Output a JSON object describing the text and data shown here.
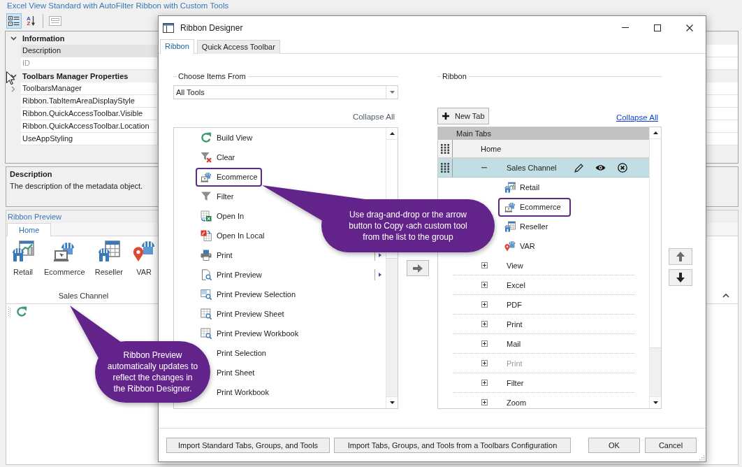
{
  "app": {
    "title": "Excel View Standard with AutoFilter Ribbon with Custom Tools",
    "toolbar": [
      {
        "kind": "categorized",
        "selected": true,
        "disabled": false
      },
      {
        "kind": "alphabetical",
        "selected": false,
        "disabled": false,
        "letters": [
          "A",
          "Z"
        ]
      },
      {
        "kind": "property-pages",
        "selected": false,
        "disabled": true
      }
    ],
    "property_grid": {
      "categories": [
        {
          "name": "Information",
          "expanded": true,
          "properties": [
            {
              "name": "Description",
              "selected": true,
              "readonly": false,
              "expandable": false
            },
            {
              "name": "ID",
              "selected": false,
              "readonly": true,
              "expandable": false
            }
          ]
        },
        {
          "name": "Toolbars Manager Properties",
          "expanded": true,
          "properties": [
            {
              "name": "ToolbarsManager",
              "selected": false,
              "readonly": false,
              "expandable": true
            },
            {
              "name": "Ribbon.TabItemAreaDisplayStyle",
              "selected": false,
              "readonly": false,
              "expandable": false
            },
            {
              "name": "Ribbon.QuickAccessToolbar.Visible",
              "selected": false,
              "readonly": false,
              "expandable": false
            },
            {
              "name": "Ribbon.QuickAccessToolbar.Location",
              "selected": false,
              "readonly": false,
              "expandable": false
            },
            {
              "name": "UseAppStyling",
              "selected": false,
              "readonly": false,
              "expandable": false
            }
          ]
        }
      ]
    },
    "description_panel": {
      "title": "Description",
      "text": "The description of the metadata object."
    },
    "ribbon_preview": {
      "title": "Ribbon Preview",
      "tabs": [
        {
          "label": "Home",
          "selected": true
        }
      ],
      "groups": [
        {
          "label": "Sales Channel",
          "tools": [
            {
              "label": "Retail"
            },
            {
              "label": "Ecommerce"
            },
            {
              "label": "Reseller"
            },
            {
              "label": "VAR"
            }
          ]
        }
      ]
    }
  },
  "dialog": {
    "title": "Ribbon Designer",
    "tabs": [
      {
        "label": "Ribbon",
        "selected": true
      },
      {
        "label": "Quick Access Toolbar",
        "selected": false
      }
    ],
    "source": {
      "heading": "Choose Items From",
      "dropdown": {
        "value": "All Tools"
      },
      "collapse_all": "Collapse All",
      "items": [
        {
          "label": "Build View",
          "selected": false,
          "highlighted": false,
          "submenu": false
        },
        {
          "label": "Clear",
          "selected": false,
          "highlighted": false,
          "submenu": false
        },
        {
          "label": "Ecommerce",
          "selected": false,
          "highlighted": true,
          "submenu": false
        },
        {
          "label": "Filter",
          "selected": false,
          "highlighted": false,
          "submenu": false
        },
        {
          "label": "Open In",
          "selected": false,
          "highlighted": false,
          "submenu": false
        },
        {
          "label": "Open In Local",
          "selected": false,
          "highlighted": false,
          "submenu": false
        },
        {
          "label": "Print",
          "selected": false,
          "highlighted": false,
          "submenu": true
        },
        {
          "label": "Print Preview",
          "selected": false,
          "highlighted": false,
          "submenu": true
        },
        {
          "label": "Print Preview Selection",
          "selected": false,
          "highlighted": false,
          "submenu": false
        },
        {
          "label": "Print Preview Sheet",
          "selected": false,
          "highlighted": false,
          "submenu": false
        },
        {
          "label": "Print Preview Workbook",
          "selected": false,
          "highlighted": false,
          "submenu": false
        },
        {
          "label": "Print Selection",
          "selected": false,
          "highlighted": false,
          "submenu": false
        },
        {
          "label": "Print Sheet",
          "selected": false,
          "highlighted": false,
          "submenu": false
        },
        {
          "label": "Print Workbook",
          "selected": false,
          "highlighted": false,
          "submenu": false
        }
      ]
    },
    "target": {
      "heading": "Ribbon",
      "new_tab": "New Tab",
      "collapse_all": "Collapse All",
      "header": "Main Tabs",
      "tabs": [
        {
          "label": "Home",
          "selected": false,
          "children": [
            {
              "label": "Sales Channel",
              "selected": true,
              "expanded": true,
              "disabled": false,
              "children": [
                {
                  "label": "Retail",
                  "selected": false,
                  "highlighted": false
                },
                {
                  "label": "Ecommerce",
                  "selected": false,
                  "highlighted": true
                },
                {
                  "label": "Reseller",
                  "selected": false,
                  "highlighted": false
                },
                {
                  "label": "VAR",
                  "selected": false,
                  "highlighted": false
                }
              ]
            },
            {
              "label": "View",
              "selected": false,
              "expanded": false,
              "disabled": false
            },
            {
              "label": "Excel",
              "selected": false,
              "expanded": false,
              "disabled": false
            },
            {
              "label": "PDF",
              "selected": false,
              "expanded": false,
              "disabled": false
            },
            {
              "label": "Print",
              "selected": false,
              "expanded": false,
              "disabled": false
            },
            {
              "label": "Mail",
              "selected": false,
              "expanded": false,
              "disabled": false
            },
            {
              "label": "Print",
              "selected": false,
              "expanded": false,
              "disabled": true
            },
            {
              "label": "Filter",
              "selected": false,
              "expanded": false,
              "disabled": false
            },
            {
              "label": "Zoom",
              "selected": false,
              "expanded": false,
              "disabled": false
            }
          ]
        }
      ]
    },
    "buttons": [
      "Import Standard Tabs, Groups, and Tools",
      "Import Tabs, Groups, and Tools from a Toolbars Configuration",
      "OK",
      "Cancel"
    ]
  },
  "callouts": [
    {
      "text": "Use drag-and-drop or the arrow\nbutton to Copy ‹ach custom tool\nfrom the list to the group"
    },
    {
      "text": "Ribbon Preview\nautomatically updates to\nreflect the changes in\nthe Ribbon Designer."
    }
  ]
}
